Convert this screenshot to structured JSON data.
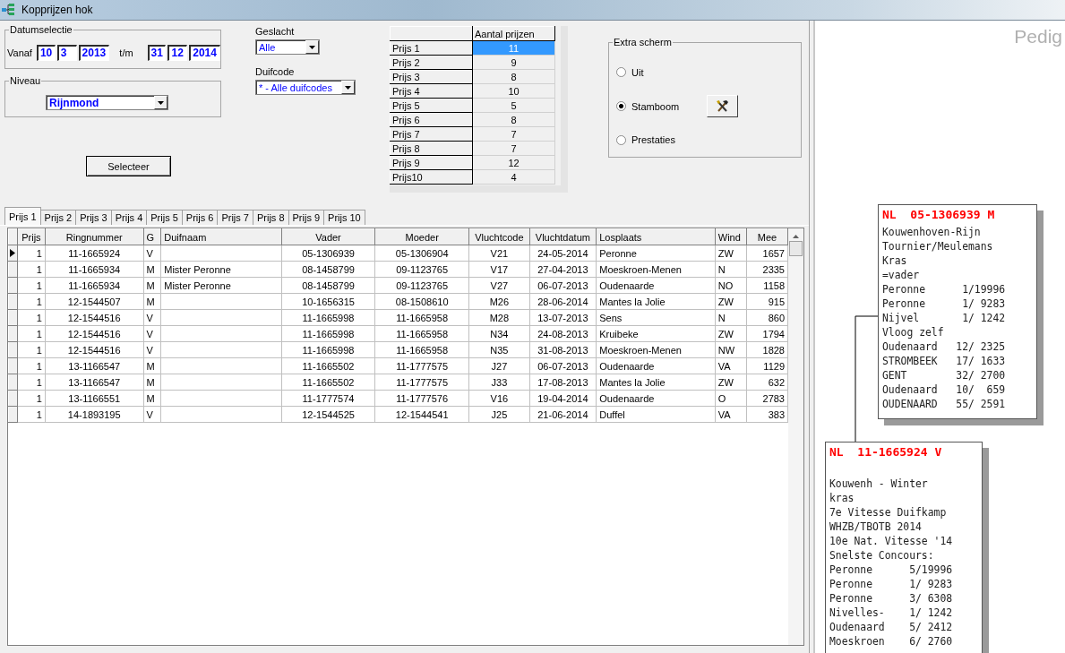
{
  "window": {
    "title": "Kopprijzen hok"
  },
  "date_selection": {
    "label": "Datumselectie",
    "from_label": "Vanaf",
    "from": [
      "10",
      "3",
      "2013"
    ],
    "to_label": "t/m",
    "to": [
      "31",
      "12",
      "2014"
    ]
  },
  "niveau": {
    "label": "Niveau",
    "value": "Rijnmond"
  },
  "geslacht": {
    "label": "Geslacht",
    "value": "Alle"
  },
  "duifcode": {
    "label": "Duifcode",
    "value": "* - Alle duifcodes"
  },
  "select_button": "Selecteer",
  "prize_table": {
    "column": "Aantal prijzen",
    "rows": [
      {
        "label": "Prijs 1",
        "count": "11",
        "selected": true
      },
      {
        "label": "Prijs 2",
        "count": "9",
        "selected": false
      },
      {
        "label": "Prijs 3",
        "count": "8",
        "selected": false
      },
      {
        "label": "Prijs 4",
        "count": "10",
        "selected": false
      },
      {
        "label": "Prijs 5",
        "count": "5",
        "selected": false
      },
      {
        "label": "Prijs 6",
        "count": "8",
        "selected": false
      },
      {
        "label": "Prijs 7",
        "count": "7",
        "selected": false
      },
      {
        "label": "Prijs 8",
        "count": "7",
        "selected": false
      },
      {
        "label": "Prijs 9",
        "count": "12",
        "selected": false
      },
      {
        "label": "Prijs10",
        "count": "4",
        "selected": false
      }
    ]
  },
  "extra_screen": {
    "label": "Extra scherm",
    "options": [
      {
        "label": "Uit",
        "selected": false,
        "tool_button": false
      },
      {
        "label": "Stamboom",
        "selected": true,
        "tool_button": true
      },
      {
        "label": "Prestaties",
        "selected": false,
        "tool_button": false
      }
    ]
  },
  "tabs": [
    {
      "label": "Prijs 1",
      "selected": true
    },
    {
      "label": "Prijs 2",
      "selected": false
    },
    {
      "label": "Prijs 3",
      "selected": false
    },
    {
      "label": "Prijs 4",
      "selected": false
    },
    {
      "label": "Prijs 5",
      "selected": false
    },
    {
      "label": "Prijs 6",
      "selected": false
    },
    {
      "label": "Prijs 7",
      "selected": false
    },
    {
      "label": "Prijs 8",
      "selected": false
    },
    {
      "label": "Prijs 9",
      "selected": false
    },
    {
      "label": "Prijs 10",
      "selected": false
    }
  ],
  "grid": {
    "columns": [
      "Prijs",
      "Ringnummer",
      "G",
      "Duifnaam",
      "Vader",
      "Moeder",
      "Vluchtcode",
      "Vluchtdatum",
      "Losplaats",
      "Wind",
      "Mee"
    ],
    "rows": [
      {
        "current": true,
        "cells": [
          "1",
          "11-1665924",
          "V",
          "",
          "05-1306939",
          "05-1306904",
          "V21",
          "24-05-2014",
          "Peronne",
          "ZW",
          "1657"
        ]
      },
      {
        "current": false,
        "cells": [
          "1",
          "11-1665934",
          "M",
          "Mister Peronne",
          "08-1458799",
          "09-1123765",
          "V17",
          "27-04-2013",
          "Moeskroen-Menen",
          "N",
          "2335"
        ]
      },
      {
        "current": false,
        "cells": [
          "1",
          "11-1665934",
          "M",
          "Mister Peronne",
          "08-1458799",
          "09-1123765",
          "V27",
          "06-07-2013",
          "Oudenaarde",
          "NO",
          "1158"
        ]
      },
      {
        "current": false,
        "cells": [
          "1",
          "12-1544507",
          "M",
          "",
          "10-1656315",
          "08-1508610",
          "M26",
          "28-06-2014",
          "Mantes la Jolie",
          "ZW",
          "915"
        ]
      },
      {
        "current": false,
        "cells": [
          "1",
          "12-1544516",
          "V",
          "",
          "11-1665998",
          "11-1665958",
          "M28",
          "13-07-2013",
          "Sens",
          "N",
          "860"
        ]
      },
      {
        "current": false,
        "cells": [
          "1",
          "12-1544516",
          "V",
          "",
          "11-1665998",
          "11-1665958",
          "N34",
          "24-08-2013",
          "Kruibeke",
          "ZW",
          "1794"
        ]
      },
      {
        "current": false,
        "cells": [
          "1",
          "12-1544516",
          "V",
          "",
          "11-1665998",
          "11-1665958",
          "N35",
          "31-08-2013",
          "Moeskroen-Menen",
          "NW",
          "1828"
        ]
      },
      {
        "current": false,
        "cells": [
          "1",
          "13-1166547",
          "M",
          "",
          "11-1665502",
          "11-1777575",
          "J27",
          "06-07-2013",
          "Oudenaarde",
          "VA",
          "1129"
        ]
      },
      {
        "current": false,
        "cells": [
          "1",
          "13-1166547",
          "M",
          "",
          "11-1665502",
          "11-1777575",
          "J33",
          "17-08-2013",
          "Mantes la Jolie",
          "ZW",
          "632"
        ]
      },
      {
        "current": false,
        "cells": [
          "1",
          "13-1166551",
          "M",
          "",
          "11-1777574",
          "11-1777576",
          "V16",
          "19-04-2014",
          "Oudenaarde",
          "O",
          "2783"
        ]
      },
      {
        "current": false,
        "cells": [
          "1",
          "14-1893195",
          "V",
          "",
          "12-1544525",
          "12-1544541",
          "J25",
          "21-06-2014",
          "Duffel",
          "VA",
          "383"
        ]
      }
    ]
  },
  "pedigree": {
    "title": "Pedig",
    "cards": [
      {
        "header": "NL  05-1306939 M",
        "blank_line": false,
        "lines": [
          "Kouwenhoven-Rijn",
          "Tournier/Meulemans",
          "Kras",
          "=vader",
          "Peronne      1/19996",
          "Peronne      1/ 9283",
          "Nijvel       1/ 1242",
          "Vloog zelf",
          "Oudenaard   12/ 2325",
          "STROMBEEK   17/ 1633",
          "GENT        32/ 2700",
          "Oudenaard   10/  659",
          "OUDENAARD   55/ 2591"
        ]
      },
      {
        "header": "NL  11-1665924 V",
        "blank_line": true,
        "lines": [
          "Kouwenh - Winter",
          "kras",
          "7e Vitesse Duifkamp",
          "WHZB/TBOTB 2014",
          "10e Nat. Vitesse '14",
          "Snelste Concours:",
          "Peronne      5/19996",
          "Peronne      1/ 9283",
          "Peronne      3/ 6308",
          "Nivelles-    1/ 1242",
          "Oudenaard    5/ 2412",
          "Moeskroen    6/ 2760"
        ]
      }
    ]
  }
}
